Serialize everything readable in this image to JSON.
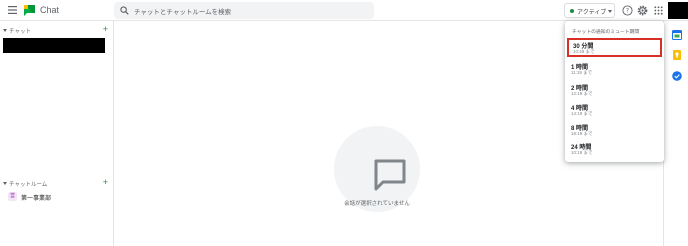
{
  "header": {
    "app_title": "Chat",
    "search_placeholder": "チャットとチャットルームを検索",
    "status_label": "アクティブ"
  },
  "sidebar": {
    "chats_label": "チャット",
    "rooms_label": "チャットルーム",
    "rooms": [
      {
        "avatar": "営",
        "name": "第一事業部"
      }
    ]
  },
  "main": {
    "empty_text": "会話が選択されていません"
  },
  "notification_menu": {
    "heading": "チャットの通知のミュート期間",
    "options": [
      {
        "duration": "30 分間",
        "until": "10:49 まで",
        "selected": true
      },
      {
        "duration": "1 時間",
        "until": "11:19 まで",
        "selected": false
      },
      {
        "duration": "2 時間",
        "until": "12:19 まで",
        "selected": false
      },
      {
        "duration": "4 時間",
        "until": "14:19 まで",
        "selected": false
      },
      {
        "duration": "8 時間",
        "until": "18:19 まで",
        "selected": false
      },
      {
        "duration": "24 時間",
        "until": "10:19 まで",
        "selected": false
      }
    ]
  },
  "colors": {
    "accent_green": "#1e8e3e",
    "selected_border": "#d93025"
  },
  "icons": [
    "menu-icon",
    "chat-logo-icon",
    "search-icon",
    "help-icon",
    "settings-icon",
    "apps-grid-icon",
    "chat-bubble-icon",
    "calendar-icon",
    "keep-icon",
    "tasks-icon",
    "add-icon"
  ]
}
